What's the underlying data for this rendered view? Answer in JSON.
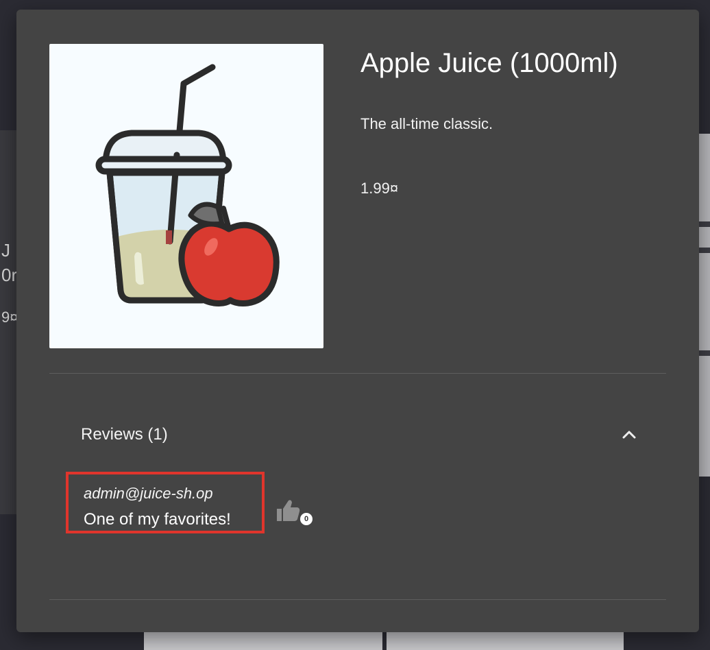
{
  "background": {
    "partial_card_lines": [
      "J",
      "0r",
      "9¤"
    ]
  },
  "product": {
    "title": "Apple Juice (1000ml)",
    "description": "The all-time classic.",
    "price": "1.99¤",
    "image_icon": "juice-cup-with-apple"
  },
  "reviews": {
    "header": "Reviews (1)",
    "expanded": true,
    "toggle_icon": "chevron-up-icon",
    "items": [
      {
        "author": "admin@juice-sh.op",
        "text": "One of my favorites!",
        "likes": "0",
        "like_icon": "thumbs-up-icon"
      }
    ]
  },
  "colors": {
    "dialog_bg": "#444444",
    "highlight_border": "#e0352c"
  }
}
